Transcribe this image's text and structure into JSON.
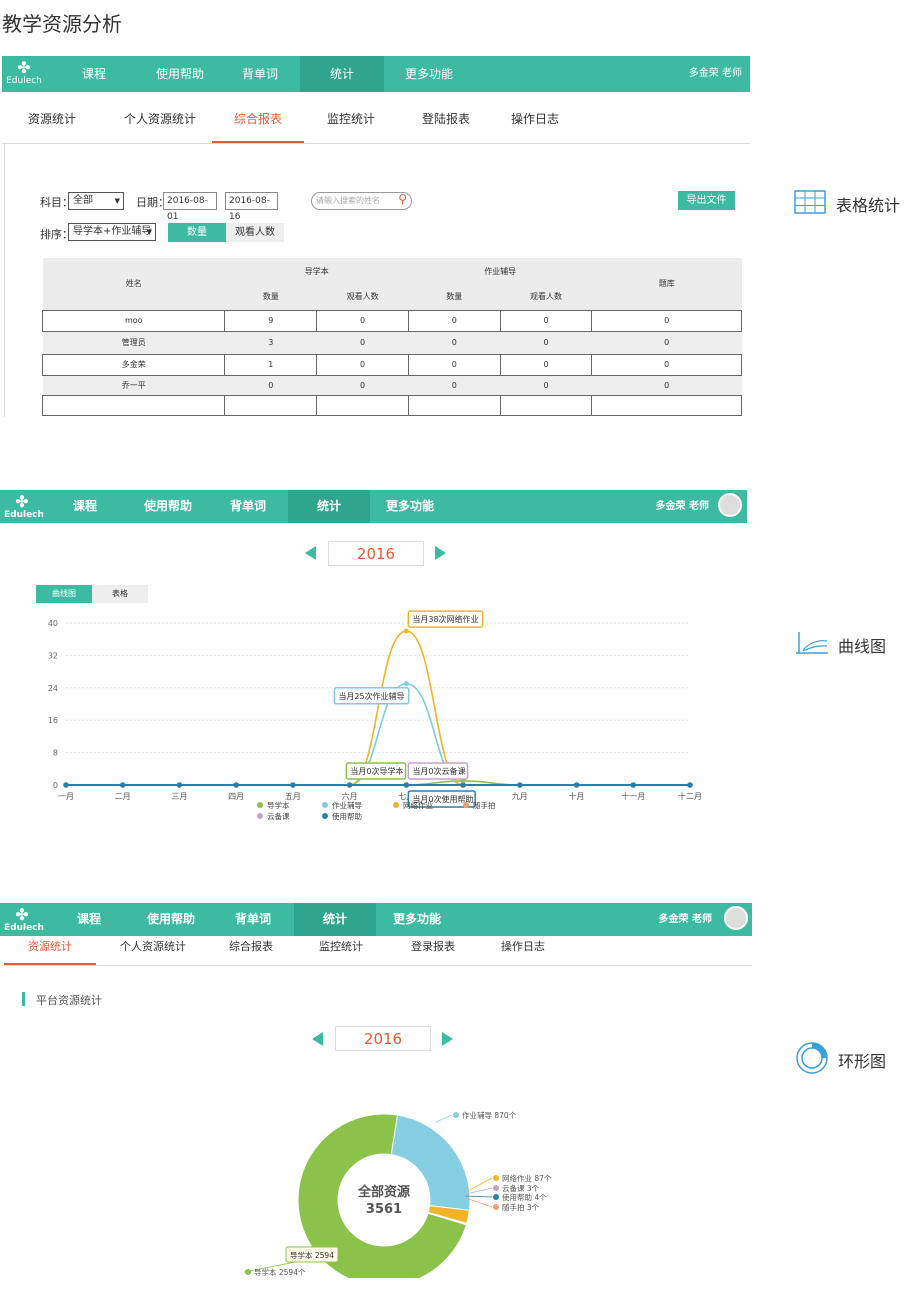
{
  "page_title": "教学资源分析",
  "nav": {
    "logo": "Edulech",
    "items": [
      "课程",
      "使用帮助",
      "背单词",
      "统计",
      "更多功能"
    ],
    "active": "统计",
    "user": "多金荣 老师"
  },
  "panel1": {
    "tabs": [
      "资源统计",
      "个人资源统计",
      "综合报表",
      "监控统计",
      "登陆报表",
      "操作日志"
    ],
    "active_tab": "综合报表",
    "filters": {
      "subject_label": "科目：",
      "subject_value": "全部",
      "date_label": "日期：",
      "date_from": "2016-08-01",
      "date_to": "2016-08-16",
      "search_placeholder": "请输入搜索的姓名",
      "export_label": "导出文件",
      "sort_label": "排序：",
      "sort_value": "导学本+作业辅导",
      "toggle_count": "数量",
      "toggle_viewers": "观看人数"
    },
    "table": {
      "col_name": "姓名",
      "group1": "导学本",
      "group2": "作业辅导",
      "col_bank": "题库",
      "sub_count": "数量",
      "sub_viewers": "观看人数",
      "rows": [
        {
          "name": "moo",
          "v": [
            "9",
            "0",
            "0",
            "0",
            "0"
          ]
        },
        {
          "name": "管理员",
          "v": [
            "3",
            "0",
            "0",
            "0",
            "0"
          ]
        },
        {
          "name": "多金荣",
          "v": [
            "1",
            "0",
            "0",
            "0",
            "0"
          ]
        },
        {
          "name": "乔一平",
          "v": [
            "0",
            "0",
            "0",
            "0",
            "0"
          ]
        },
        {
          "name": "",
          "v": [
            "",
            "",
            "",
            "",
            ""
          ]
        }
      ]
    },
    "side_label": "表格统计"
  },
  "panel2": {
    "user": "多金荣 老师",
    "year": "2016",
    "view_tabs": [
      "曲线图",
      "表格"
    ],
    "active_view": "曲线图",
    "side_label": "曲线图",
    "chart_data": {
      "type": "line",
      "x": [
        "一月",
        "二月",
        "三月",
        "四月",
        "五月",
        "六月",
        "七月",
        "八月",
        "九月",
        "十月",
        "十一月",
        "十二月"
      ],
      "ylim": [
        0,
        40
      ],
      "yticks": [
        0,
        8,
        16,
        24,
        32,
        40
      ],
      "series": [
        {
          "name": "导学本",
          "color": "#8bc34a",
          "values": [
            0,
            0,
            0,
            0,
            0,
            0,
            0,
            1,
            0,
            0,
            0,
            0
          ]
        },
        {
          "name": "作业辅导",
          "color": "#7ecbe0",
          "values": [
            0,
            0,
            0,
            0,
            0,
            0,
            25,
            0,
            0,
            0,
            0,
            0
          ]
        },
        {
          "name": "网络作业",
          "color": "#f0b429",
          "values": [
            0,
            0,
            0,
            0,
            0,
            0,
            38,
            0,
            0,
            0,
            0,
            0
          ]
        },
        {
          "name": "随手拍",
          "color": "#f59e6b",
          "values": [
            0,
            0,
            0,
            0,
            0,
            0,
            0,
            0,
            0,
            0,
            0,
            0
          ]
        },
        {
          "name": "云备课",
          "color": "#c9a0c8",
          "values": [
            0,
            0,
            0,
            0,
            0,
            0,
            0,
            0,
            0,
            0,
            0,
            0
          ]
        },
        {
          "name": "使用帮助",
          "color": "#2a7fa8",
          "values": [
            0,
            0,
            0,
            0,
            0,
            0,
            0,
            0,
            0,
            0,
            0,
            0
          ]
        }
      ],
      "annotations": [
        "当月38次网络作业",
        "当月25次作业辅导",
        "当月0次导学本",
        "当月0次云备课",
        "当月0次使用帮助"
      ]
    }
  },
  "panel3": {
    "tabs": [
      "资源统计",
      "个人资源统计",
      "综合报表",
      "监控统计",
      "登录报表",
      "操作日志"
    ],
    "active_tab": "资源统计",
    "section_title": "平台资源统计",
    "year": "2016",
    "side_label": "环形图",
    "chart_data": {
      "type": "pie",
      "center_label": "全部资源",
      "total": 3561,
      "slices": [
        {
          "name": "导学本",
          "value": 2594,
          "label": "导学本 2594个",
          "color": "#8bc34a"
        },
        {
          "name": "作业辅导",
          "value": 870,
          "label": "作业辅导 870个",
          "color": "#86cfe3"
        },
        {
          "name": "网络作业",
          "value": 87,
          "label": "网络作业 87个",
          "color": "#f0b429"
        },
        {
          "name": "云备课",
          "value": 3,
          "label": "云备课 3个",
          "color": "#c9a0c8"
        },
        {
          "name": "使用帮助",
          "value": 4,
          "label": "使用帮助 4个",
          "color": "#2a7fa8"
        },
        {
          "name": "随手拍",
          "value": 3,
          "label": "随手拍 3个",
          "color": "#f59e6b"
        }
      ],
      "tooltip": "导学本 2594"
    }
  }
}
